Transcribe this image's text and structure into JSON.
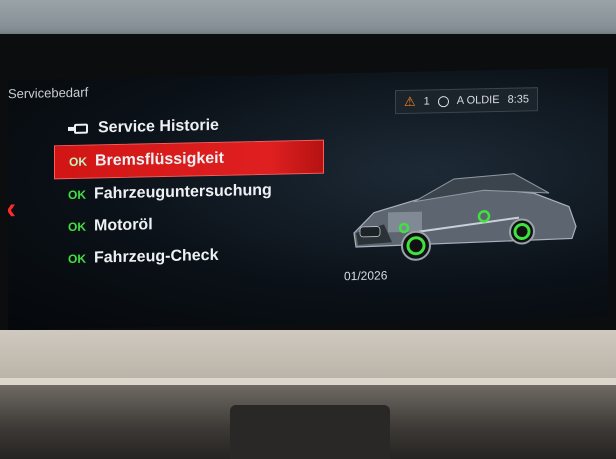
{
  "header": {
    "title": "Servicebedarf",
    "warning_count": "1",
    "radio_station": "A OLDIE",
    "time": "8:35"
  },
  "menu": {
    "items": [
      {
        "label": "Service Historie",
        "status": ""
      },
      {
        "label": "Bremsflüssigkeit",
        "status": "OK",
        "selected": true
      },
      {
        "label": "Fahrzeuguntersuchung",
        "status": "OK"
      },
      {
        "label": "Motoröl",
        "status": "OK"
      },
      {
        "label": "Fahrzeug-Check",
        "status": "OK"
      }
    ]
  },
  "detail": {
    "due_date": "01/2026"
  },
  "colors": {
    "selection": "#d11515",
    "ok": "#3fe23f",
    "warning": "#ff8a1c"
  },
  "icons": [
    "warning-icon",
    "clock-icon",
    "service-history-icon",
    "back-arrow-icon",
    "car-image"
  ]
}
